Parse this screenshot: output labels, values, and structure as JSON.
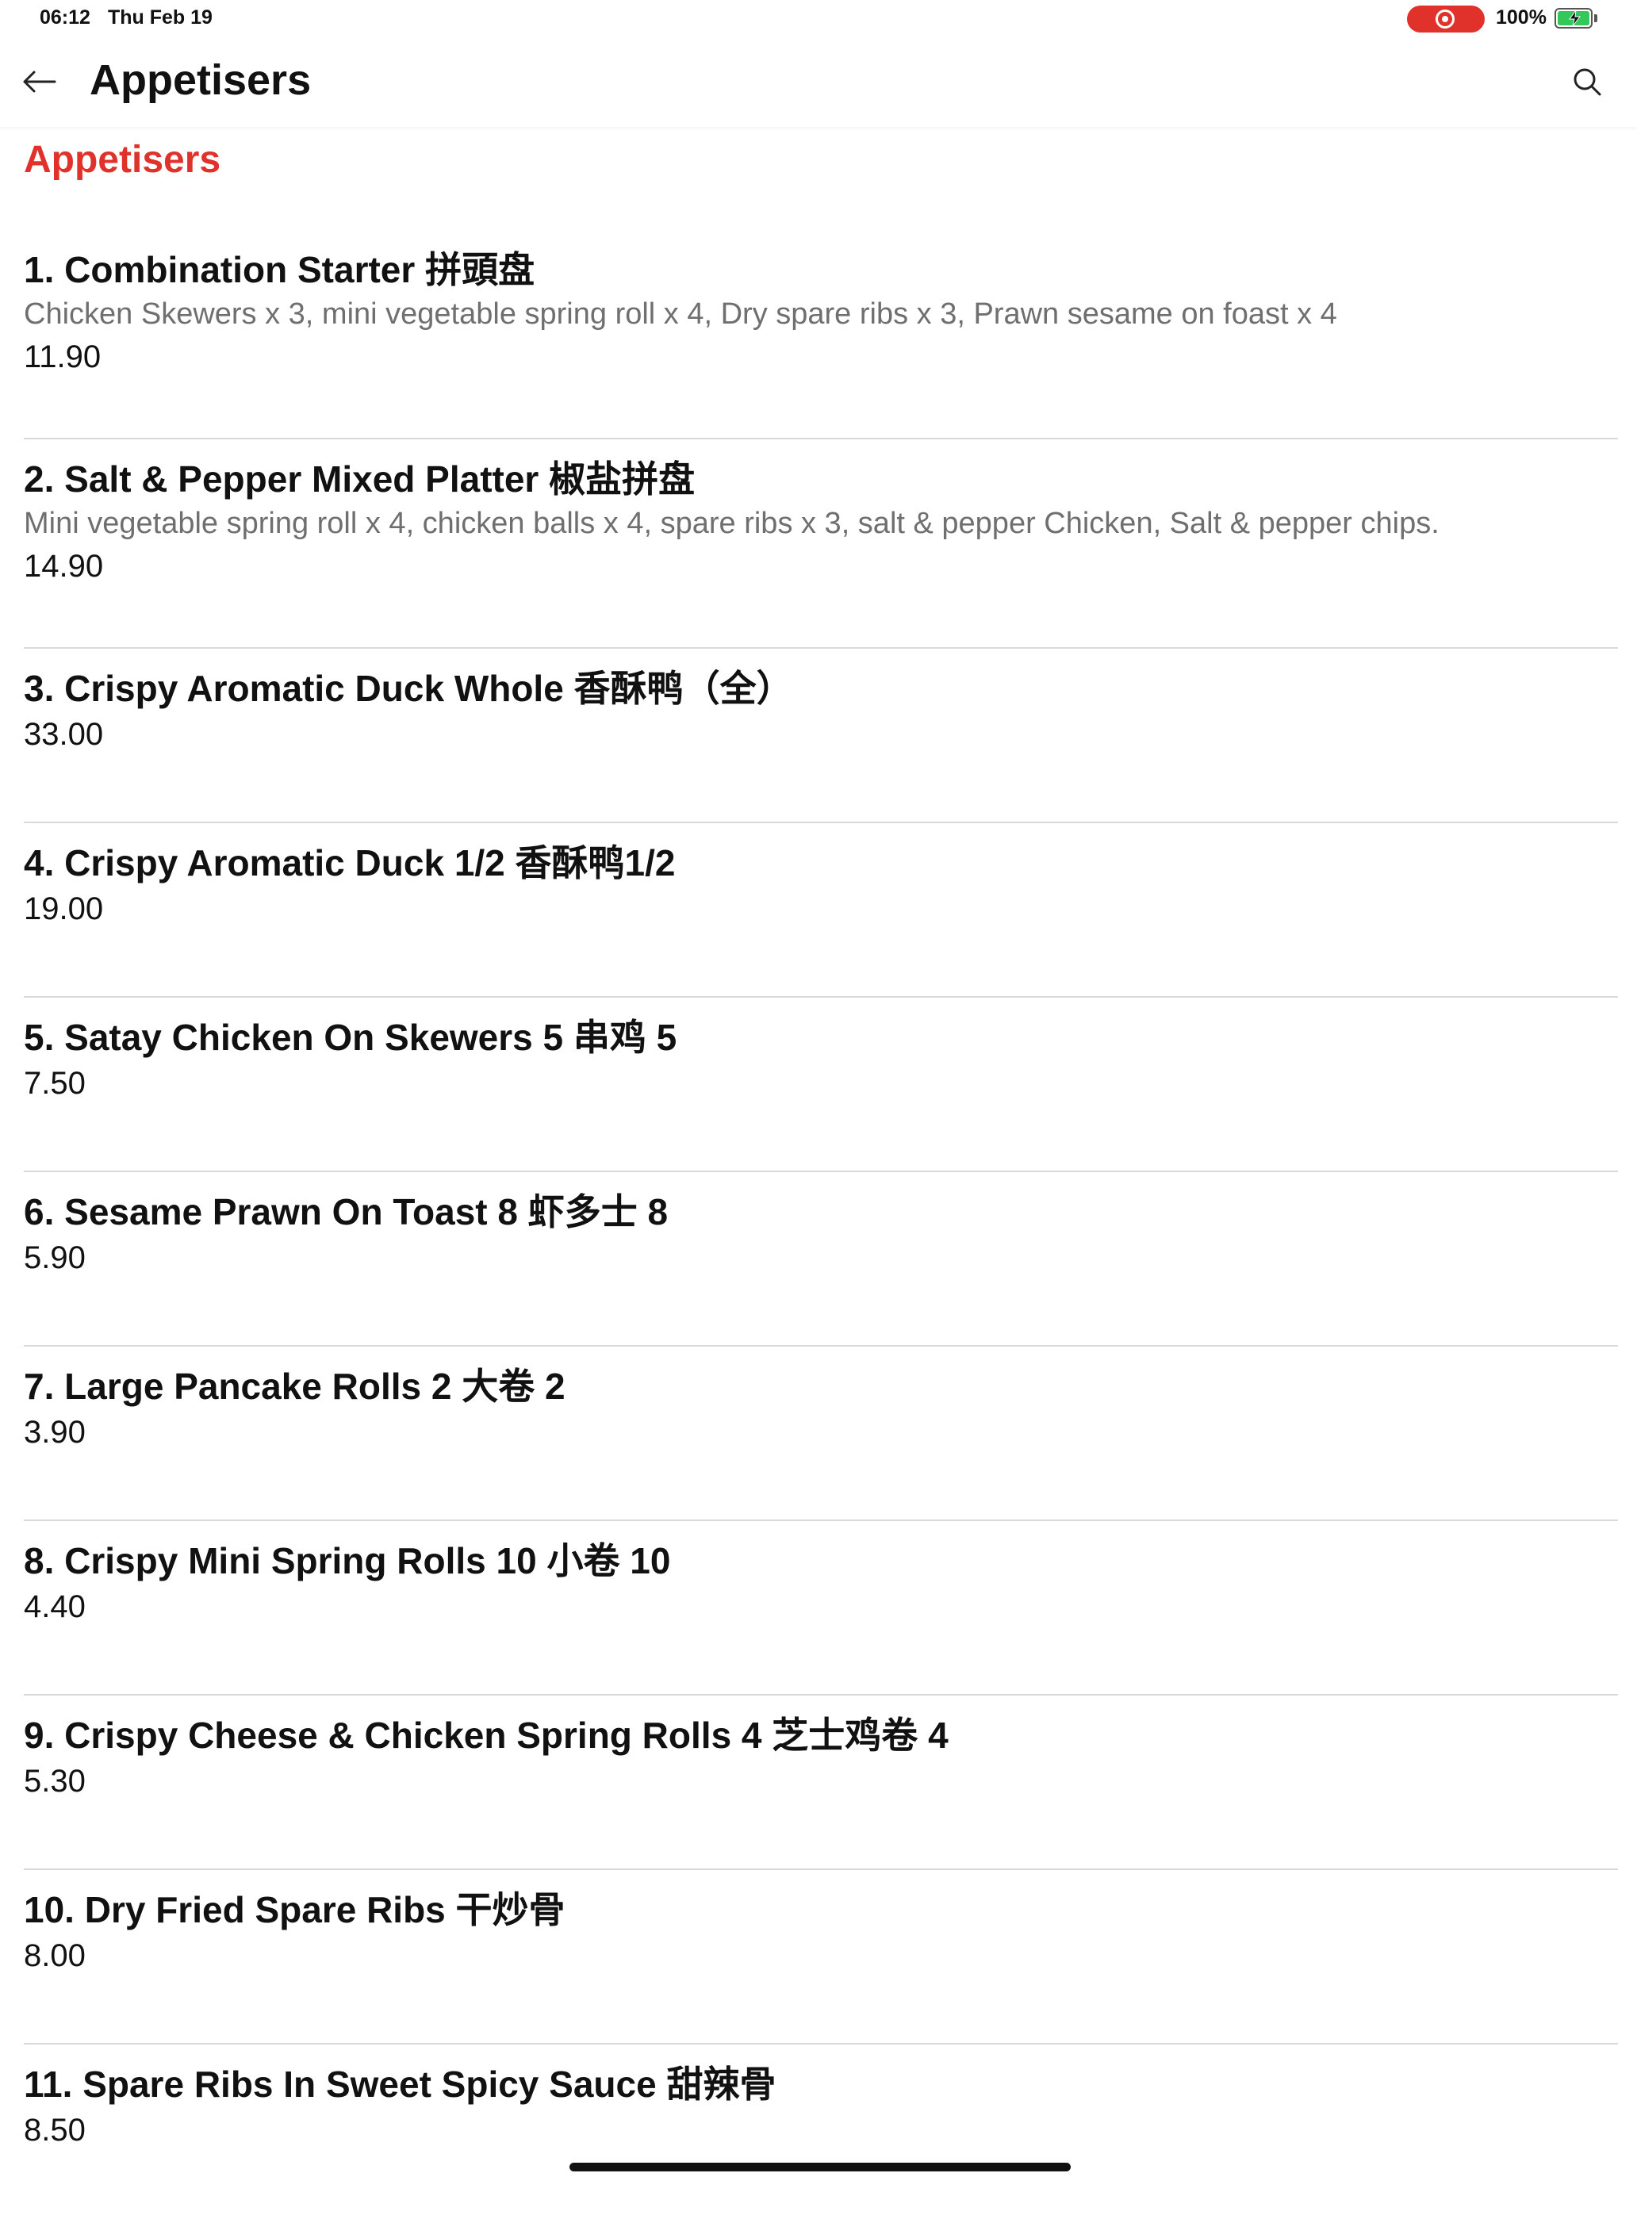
{
  "status_bar": {
    "time": "06:12",
    "date": "Thu Feb 19",
    "battery_percent": "100%",
    "record_color": "#e0322b",
    "battery_color": "#34c759"
  },
  "header": {
    "title": "Appetisers",
    "back_icon": "arrow-left-icon",
    "search_icon": "search-icon"
  },
  "section": {
    "title": "Appetisers",
    "accent_color": "#e0322b"
  },
  "items": [
    {
      "name": "1. Combination Starter 拼頭盘",
      "description": "Chicken Skewers x 3, mini vegetable spring roll x 4, Dry spare ribs x 3, Prawn sesame on foast x 4",
      "price": "11.90"
    },
    {
      "name": "2. Salt & Pepper Mixed Platter 椒盐拼盘",
      "description": "Mini vegetable spring roll x 4, chicken balls x 4, spare ribs x 3, salt & pepper Chicken, Salt & pepper chips.",
      "price": "14.90"
    },
    {
      "name": "3. Crispy Aromatic Duck Whole 香酥鸭（全）",
      "description": "",
      "price": "33.00"
    },
    {
      "name": "4. Crispy Aromatic Duck 1/2 香酥鸭1/2",
      "description": "",
      "price": "19.00"
    },
    {
      "name": "5. Satay Chicken On Skewers 5 串鸡 5",
      "description": "",
      "price": "7.50"
    },
    {
      "name": "6. Sesame Prawn On Toast 8 虾多士 8",
      "description": "",
      "price": "5.90"
    },
    {
      "name": "7. Large Pancake Rolls 2 大卷 2",
      "description": "",
      "price": "3.90"
    },
    {
      "name": "8. Crispy Mini Spring Rolls 10 小卷 10",
      "description": "",
      "price": "4.40"
    },
    {
      "name": "9. Crispy Cheese & Chicken Spring Rolls 4 芝士鸡卷 4",
      "description": "",
      "price": "5.30"
    },
    {
      "name": "10. Dry Fried Spare Ribs 干炒骨",
      "description": "",
      "price": "8.00"
    },
    {
      "name": "11. Spare Ribs In Sweet Spicy Sauce 甜辣骨",
      "description": "",
      "price": "8.50"
    }
  ]
}
